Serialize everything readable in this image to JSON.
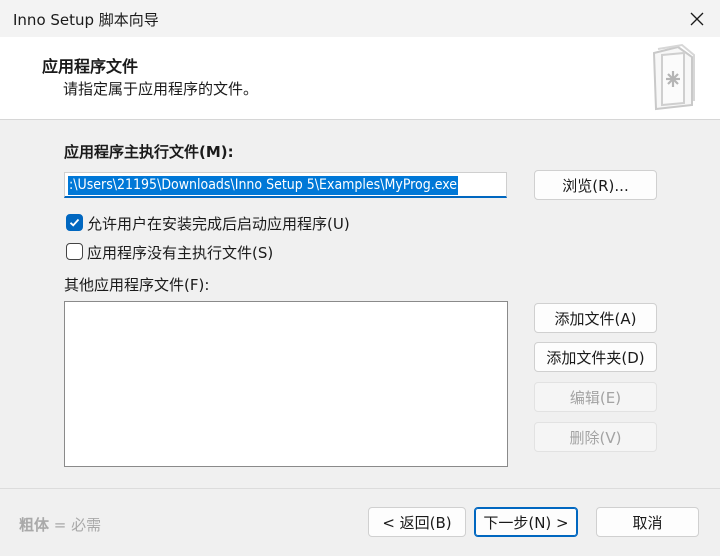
{
  "window": {
    "title": "Inno Setup 脚本向导",
    "close_icon": "close-icon"
  },
  "header": {
    "title": "应用程序文件",
    "subtitle": "请指定属于应用程序的文件。",
    "icon": "wizard-file-icon"
  },
  "main_exe": {
    "label": "应用程序主执行文件(M):",
    "value": ":\\Users\\21195\\Downloads\\Inno Setup 5\\Examples\\MyProg.exe",
    "browse_label": "浏览(R)..."
  },
  "options": {
    "allow_start_label": "允许用户在安装完成后启动应用程序(U)",
    "allow_start_checked": true,
    "no_main_exe_label": "应用程序没有主执行文件(S)",
    "no_main_exe_checked": false
  },
  "other_files": {
    "label": "其他应用程序文件(F):",
    "items": [],
    "add_file_label": "添加文件(A)",
    "add_folder_label": "添加文件夹(D)",
    "edit_label": "编辑(E)",
    "remove_label": "删除(V)"
  },
  "footer": {
    "hint_bold": "粗体",
    "hint_rest": " = 必需",
    "back_label": "< 返回(B)",
    "next_label": "下一步(N) >",
    "cancel_label": "取消"
  },
  "colors": {
    "accent": "#0067c0",
    "selection": "#0078d7",
    "disabled_text": "#a3a3a3"
  }
}
